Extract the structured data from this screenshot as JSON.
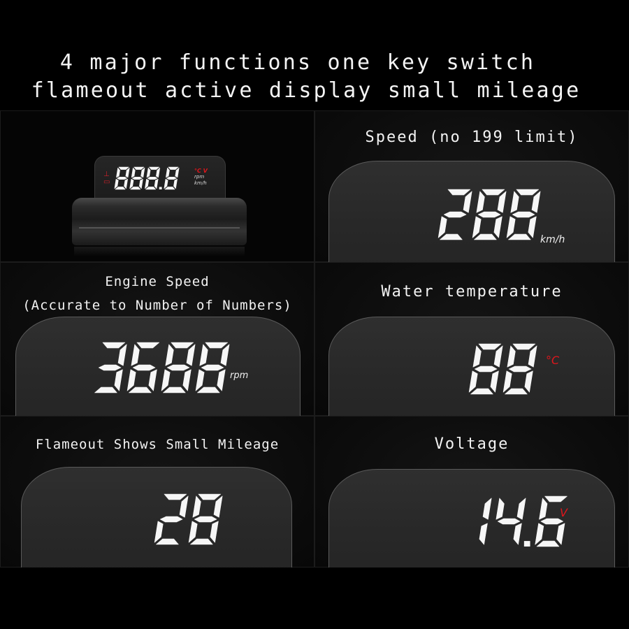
{
  "banner": {
    "line1": "4 major functions one key switch",
    "line2": "flameout active display small mileage"
  },
  "product": {
    "readout": "888.8",
    "units": [
      "°C V",
      "rpm",
      "km/h"
    ],
    "indicator_icons": [
      "engine-temp-icon",
      "battery-icon"
    ],
    "accent_color": "#e0161c"
  },
  "panels": {
    "speed": {
      "title": "Speed (no 199 limit)",
      "value": "288",
      "unit": "km/h",
      "unit_color": "#f0f0f0"
    },
    "engine": {
      "title_line1": "Engine Speed",
      "title_line2": "(Accurate to Number of Numbers)",
      "value": "3688",
      "unit": "rpm",
      "unit_color": "#f0f0f0"
    },
    "water": {
      "title": "Water temperature",
      "value": "88",
      "unit": "°C",
      "unit_color": "#e0161c"
    },
    "mileage": {
      "title": "Flameout Shows Small Mileage",
      "value": "28",
      "unit": "",
      "unit_color": "#f0f0f0"
    },
    "voltage": {
      "title": "Voltage",
      "value": "14.6",
      "unit": "V",
      "unit_color": "#e0161c"
    }
  }
}
